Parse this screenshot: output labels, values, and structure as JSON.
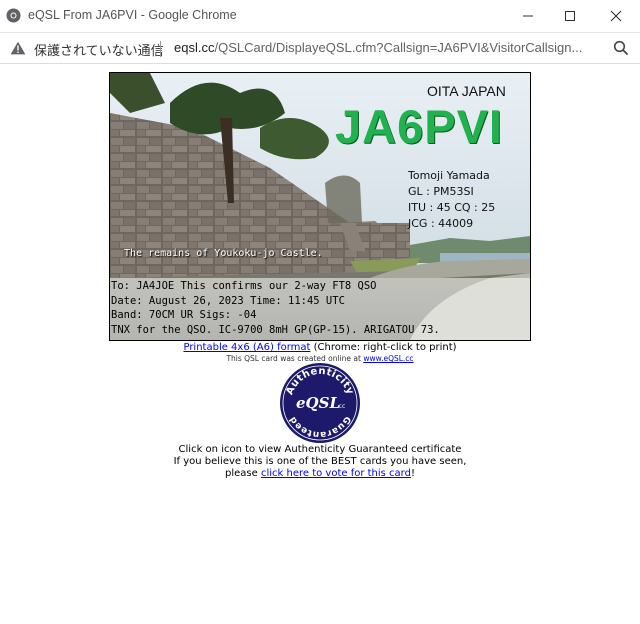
{
  "window": {
    "title": "eQSL From JA6PVI - Google Chrome",
    "not_secure_label": "保護されていない通信",
    "url_host": "eqsl.cc",
    "url_path": "/QSLCard/DisplayeQSL.cfm?Callsign=JA6PVI&VisitorCallsign..."
  },
  "card": {
    "location": "OITA JAPAN",
    "callsign": "JA6PVI",
    "operator": "Tomoji Yamada",
    "gl": "GL : PM53SI",
    "itu_cq": "ITU : 45   CQ : 25",
    "jcg": "JCG : 44009",
    "photo_caption": "The remains of Youkoku-jo Castle.",
    "qso_lines": [
      "To: JA4JOE This confirms our 2-way FT8 QSO",
      "Date: August 26, 2023  Time: 11:45 UTC",
      "Band: 70CM UR Sigs: -04",
      "TNX for the QSO. IC-9700 8mH GP(GP-15). ARIGATOU 73."
    ]
  },
  "links": {
    "printable_link": "Printable 4x6 (A6) format",
    "printable_note": " (Chrome: right-click to print)",
    "created_text": "This QSL card was created online at ",
    "created_link": "www.eQSL.cc",
    "cert_line": "Click on icon to view Authenticity Guaranteed certificate",
    "best_line": "If you believe this is one of the BEST cards you have seen,",
    "please": "please ",
    "vote_link": "click here to vote for this card",
    "vote_end": "!"
  },
  "seal": {
    "top_text": "Authenticity",
    "center_text": "eQSL",
    "center_suffix": ".cc",
    "bottom_text": "Guaranteed"
  },
  "colors": {
    "callsign_green": "#21b14e",
    "seal_navy": "#1d1a6b"
  }
}
